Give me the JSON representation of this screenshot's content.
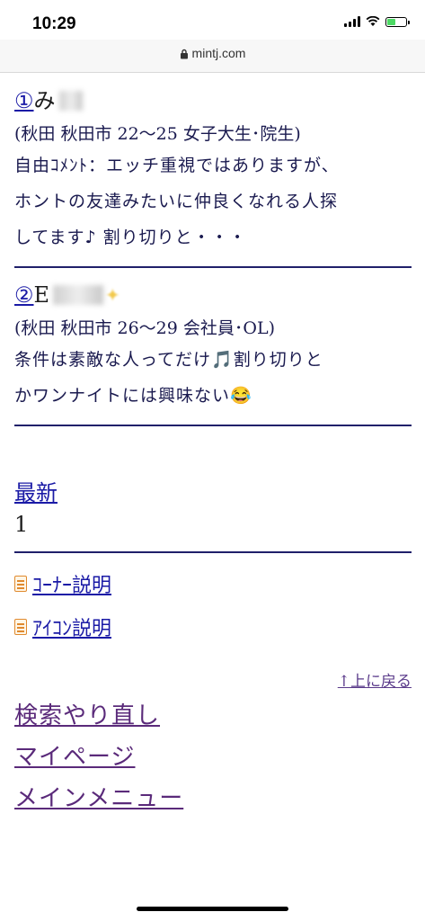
{
  "status": {
    "time": "10:29",
    "url": "mintj.com"
  },
  "entries": [
    {
      "number": "①",
      "name": "み",
      "meta": "(秋田 秋田市 22〜25 女子大生･院生)",
      "comment_line1": "自由ｺﾒﾝﾄ：エッチ重視ではありますが、",
      "comment_line2": "ホントの友達みたいに仲良くなれる人探",
      "comment_line3": "してます♪ 割り切りと・・・"
    },
    {
      "number": "②",
      "name": "E",
      "meta": "(秋田 秋田市 26〜29 会社員･OL)",
      "comment_line1": "条件は素敵な人ってだけ🎵割り切りと",
      "comment_line2": "かワンナイトには興味ない😂"
    }
  ],
  "pagination": {
    "latest_label": "最新",
    "page": "1"
  },
  "help_links": {
    "corner": "ｺｰﾅｰ説明",
    "icon": "ｱｲｺﾝ説明"
  },
  "back_to_top": "↑上に戻る",
  "nav": {
    "search_again": "検索やり直し",
    "mypage": "マイページ",
    "main_menu": "メインメニュー"
  }
}
